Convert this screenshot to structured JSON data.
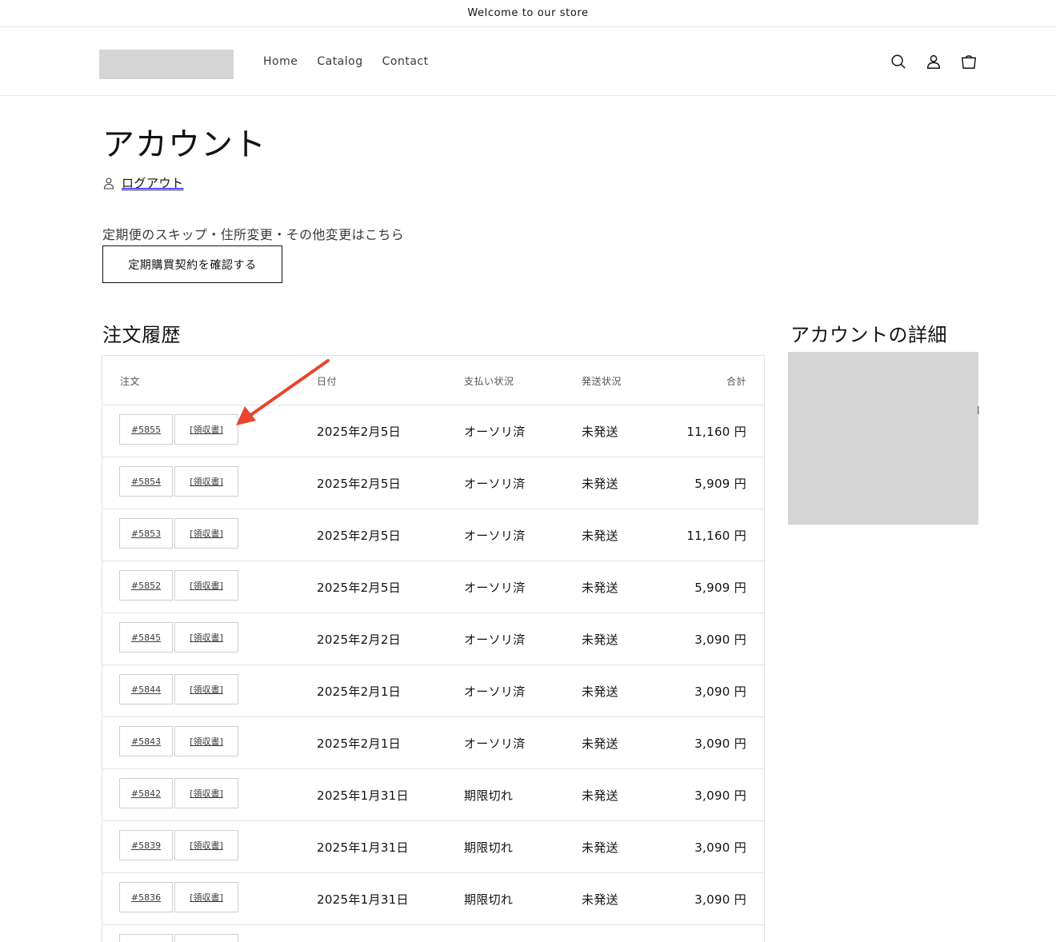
{
  "announcement": "Welcome to our store",
  "nav": {
    "items": [
      "Home",
      "Catalog",
      "Contact"
    ]
  },
  "header_icons": [
    "search-icon",
    "account-icon",
    "cart-icon"
  ],
  "page": {
    "title": "アカウント",
    "logout": "ログアウト",
    "subscription_note": "定期便のスキップ・住所変更・その他変更はこちら",
    "subscription_button": "定期購買契約を確認する"
  },
  "orders": {
    "title": "注文履歴",
    "columns": {
      "order": "注文",
      "date": "日付",
      "payment": "支払い状況",
      "fulfillment": "発送状況",
      "total": "合計"
    },
    "receipt_label": "[領収書]",
    "rows": [
      {
        "number": "#5855",
        "date": "2025年2月5日",
        "payment": "オーソリ済",
        "fulfillment": "未発送",
        "total": "11,160 円"
      },
      {
        "number": "#5854",
        "date": "2025年2月5日",
        "payment": "オーソリ済",
        "fulfillment": "未発送",
        "total": "5,909 円"
      },
      {
        "number": "#5853",
        "date": "2025年2月5日",
        "payment": "オーソリ済",
        "fulfillment": "未発送",
        "total": "11,160 円"
      },
      {
        "number": "#5852",
        "date": "2025年2月5日",
        "payment": "オーソリ済",
        "fulfillment": "未発送",
        "total": "5,909 円"
      },
      {
        "number": "#5845",
        "date": "2025年2月2日",
        "payment": "オーソリ済",
        "fulfillment": "未発送",
        "total": "3,090 円"
      },
      {
        "number": "#5844",
        "date": "2025年2月1日",
        "payment": "オーソリ済",
        "fulfillment": "未発送",
        "total": "3,090 円"
      },
      {
        "number": "#5843",
        "date": "2025年2月1日",
        "payment": "オーソリ済",
        "fulfillment": "未発送",
        "total": "3,090 円"
      },
      {
        "number": "#5842",
        "date": "2025年1月31日",
        "payment": "期限切れ",
        "fulfillment": "未発送",
        "total": "3,090 円"
      },
      {
        "number": "#5839",
        "date": "2025年1月31日",
        "payment": "期限切れ",
        "fulfillment": "未発送",
        "total": "3,090 円"
      },
      {
        "number": "#5836",
        "date": "2025年1月31日",
        "payment": "期限切れ",
        "fulfillment": "未発送",
        "total": "3,090 円"
      },
      {
        "number": "",
        "date": "",
        "payment": "",
        "fulfillment": "",
        "total": ""
      }
    ]
  },
  "account_details": {
    "title": "アカウントの詳細",
    "overflow_text": "l"
  },
  "colors": {
    "text": "#121212",
    "border": "#e3e3e3",
    "placeholder": "#d5d5d5",
    "annotation_arrow": "#e8442f"
  }
}
